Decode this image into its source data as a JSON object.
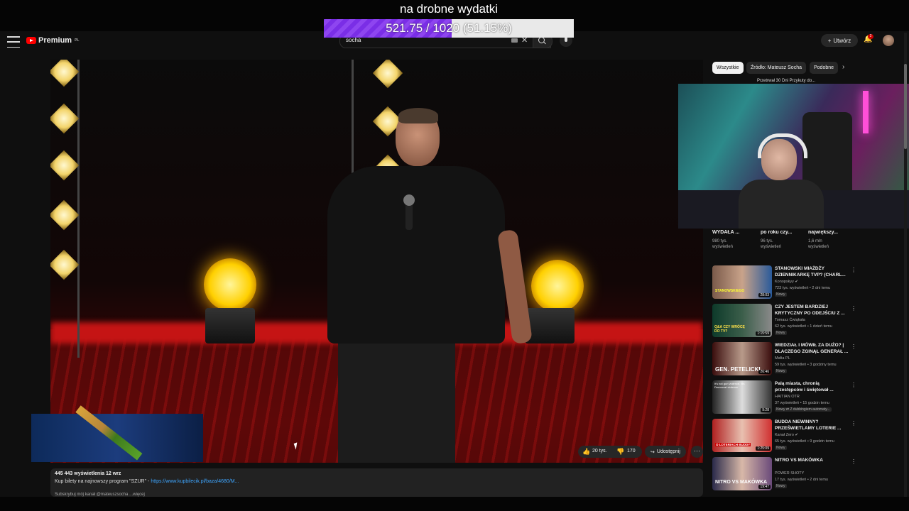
{
  "overlay": {
    "title": "na drobne wydatki",
    "progress_text": "521.75 / 1020 (51.15%)",
    "progress_fraction": 0.5115,
    "fill_color": "#7a2ee6"
  },
  "header": {
    "logo_text": "Premium",
    "logo_sup": "PL",
    "search_value": "socha",
    "create_label": "Utwórz",
    "notification_count": "2"
  },
  "video_actions": {
    "likes": "20 tys.",
    "dislikes": "170",
    "share_label": "Udostępnij",
    "more": "⋯"
  },
  "description": {
    "stats": "445 443 wyświetlenia  12 wrz",
    "line_text": "Kup bilety na najnowszy program \"SZUR\" - ",
    "link": "https://www.kupbilecik.pl/baza/4680/M...",
    "line2_a": "Subskrybuj mój kanał",
    "line2_b": "@mateuszsocha",
    "line2_c": "...więcej"
  },
  "chips": [
    "Wszystkie",
    "Źródło: Mateusz Socha",
    "Podobne"
  ],
  "top_partial_title": "Przetrwał 30 Dni Przykuty do...",
  "shorts": [
    {
      "title": "WYDAŁA ...",
      "views_a": "980 tys.",
      "views_b": "wyświetleń"
    },
    {
      "title": "po roku czy...",
      "views_a": "96 tys.",
      "views_b": "wyświetleń"
    },
    {
      "title": "największy...",
      "views_a": "1,6 mln",
      "views_b": "wyświetleń"
    }
  ],
  "videos": [
    {
      "title": "STANOWSKI MIAŻDŻY DZIENNIKARKĘ TVP? (CHARL...",
      "channel": "Konopskyy ✔",
      "meta": "723 tys. wyświetleń • 2 dni temu",
      "badge": "Nowy",
      "duration": "28:03"
    },
    {
      "title": "CZY JESTEM BARDZIEJ KRYTYCZNY PO ODEJŚCIU Z ...",
      "channel": "Tomasz Ćwiąkała",
      "meta": "62 tys. wyświetleń • 1 dzień temu",
      "badge": "Nowy",
      "duration": "1:15:59"
    },
    {
      "title": "WIEDZIAŁ I MÓWIŁ ZA DUŻO? | DLACZEGO ZGINĄŁ GENERAŁ ...",
      "channel": "Mafia PL",
      "meta": "59 tys. wyświetleń • 3 godziny temu",
      "badge": "Nowy",
      "duration": "26:46"
    },
    {
      "title": "Palą miasta, chronią przestępców i świętował ...",
      "channel": "HAITIAN OTR",
      "meta": "37 wyświetleń • 15 godzin temu",
      "badge": "Nowy  ⇄ Z dubbingiem automaty...",
      "duration": "9:28"
    },
    {
      "title": "BUDDA NIEWINNY? PRZEŚWIETLAMY LOTERIE ...",
      "channel": "Kanał Zero ✔",
      "meta": "65 tys. wyświetleń • 9 godzin temu",
      "badge": "Nowy",
      "duration": "1:25:09"
    },
    {
      "title": "NITRO VS MAKÓWKA",
      "channel": "POWER SHOTY",
      "meta": "17 tys. wyświetleń • 2 dni temu",
      "badge": "Nowy",
      "duration": "19:47"
    }
  ],
  "thumb_overlays": [
    "STANOWSKIEGO",
    "Q&A CZY WRÓCĘ DO TV?",
    "GEN. PETELICKI",
    "It's not gun violence. It's Democrat violence.",
    "O LOTERIACH BUDDY",
    "NITRO VS MAKÓWKA"
  ],
  "colors": {
    "brand": "#ff0000",
    "link": "#3ea6ff",
    "background": "#0f0f0f"
  }
}
